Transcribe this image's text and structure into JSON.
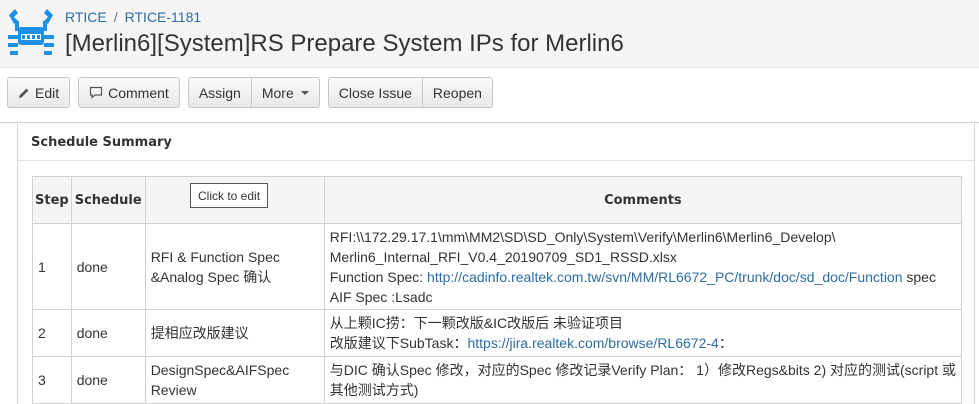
{
  "breadcrumb": {
    "project": "RTICE",
    "separator": "/",
    "issue_key": "RTICE-1181"
  },
  "issue": {
    "title": "[Merlin6][System]RS Prepare System IPs for Merlin6"
  },
  "toolbar": {
    "edit": "Edit",
    "comment": "Comment",
    "assign": "Assign",
    "more": "More",
    "close_issue": "Close Issue",
    "reopen": "Reopen"
  },
  "icons": {
    "logo": "realtek-crab-logo-icon",
    "edit": "pencil-icon",
    "comment": "speech-bubble-icon",
    "more": "chevron-down-icon"
  },
  "colors": {
    "logo": "#1e90e6",
    "link": "#2d6ca2"
  },
  "schedule": {
    "heading": "Schedule Summary",
    "tooltip": "Click to edit",
    "columns": {
      "step": "Step",
      "schedule": "Schedule",
      "description": "",
      "comments": "Comments"
    },
    "rows": [
      {
        "step": "1",
        "schedule": "done",
        "description": "RFI & Function Spec &Analog Spec 确认",
        "comment_line1": "RFI:\\\\172.29.17.1\\mm\\MM2\\SD\\SD_Only\\System\\Verify\\Merlin6\\Merlin6_Develop\\",
        "comment_line2": "Merlin6_Internal_RFI_V0.4_20190709_SD1_RSSD.xlsx",
        "comment_line3_prefix": "Function Spec: ",
        "comment_line3_link": "http://cadinfo.realtek.com.tw/svn/MM/RL6672_PC/trunk/doc/sd_doc/Function",
        "comment_line3_suffix": " spec",
        "comment_line4": "AIF Spec :Lsadc"
      },
      {
        "step": "2",
        "schedule": "done",
        "description": "提相应改版建议",
        "comment_line1": "从上颗IC捞：下一颗改版&IC改版后 未验证项目",
        "comment_line2_prefix": "改版建议下SubTask：",
        "comment_line2_link": "https://jira.realtek.com/browse/RL6672-4",
        "comment_line2_suffix": "："
      },
      {
        "step": "3",
        "schedule": "done",
        "description": "DesignSpec&AIFSpec Review",
        "comment_line1": "与DIC 确认Spec 修改，对应的Spec 修改记录Verify Plan： 1）修改Regs&bits 2) 对应的测试(script 或",
        "comment_line2": "其他测试方式)"
      }
    ]
  }
}
